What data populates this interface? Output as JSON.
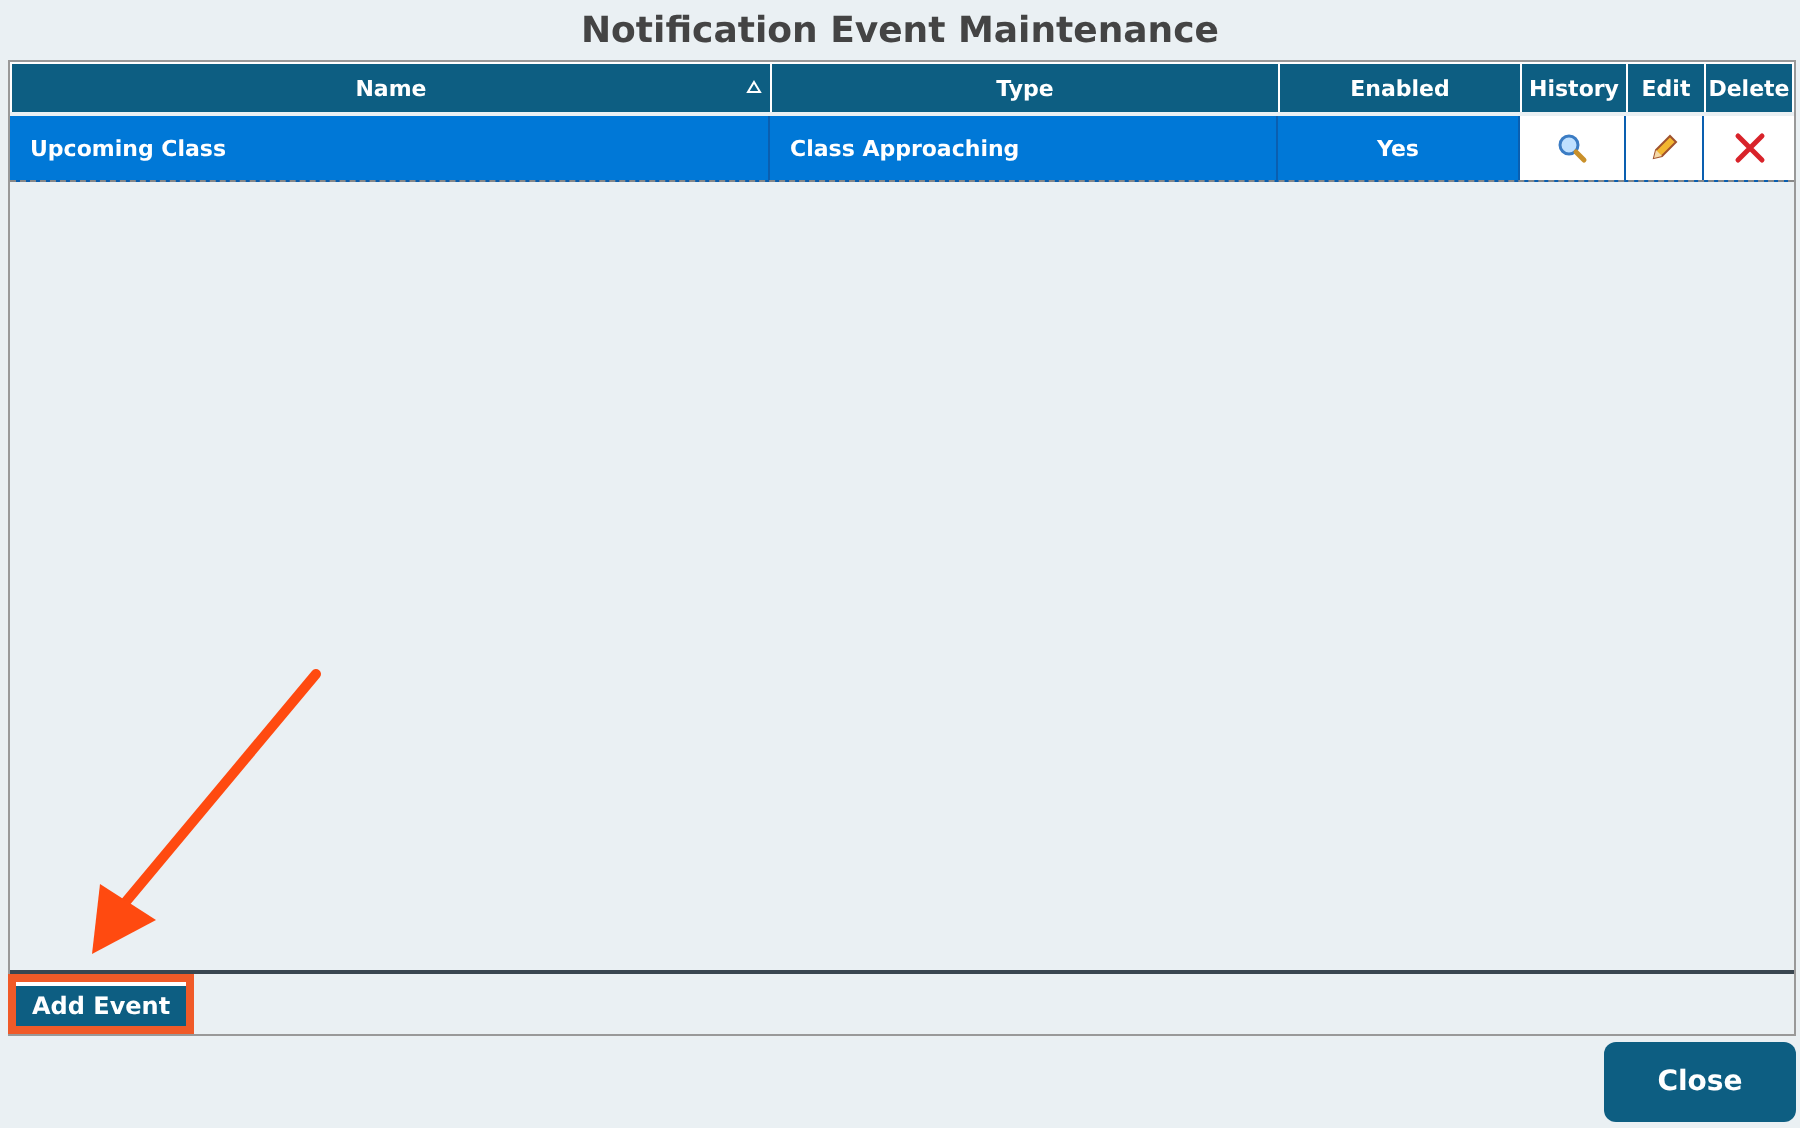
{
  "title": "Notification Event Maintenance",
  "table": {
    "columns": [
      {
        "label": "Name",
        "sorted": true
      },
      {
        "label": "Type",
        "sorted": false
      },
      {
        "label": "Enabled",
        "sorted": false
      },
      {
        "label": "History",
        "sorted": false
      },
      {
        "label": "Edit",
        "sorted": false
      },
      {
        "label": "Delete",
        "sorted": false
      }
    ],
    "rows": [
      {
        "name": "Upcoming Class",
        "type": "Class Approaching",
        "enabled": "Yes",
        "selected": true
      }
    ]
  },
  "add_button": {
    "label": "Add Event",
    "highlighted": true
  },
  "close_button": {
    "label": "Close"
  }
}
